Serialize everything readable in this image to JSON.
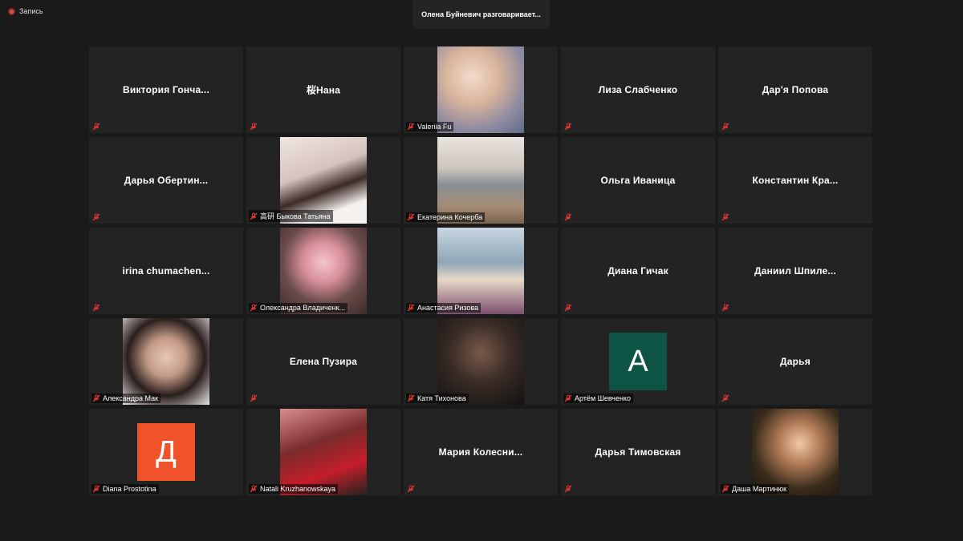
{
  "recording": {
    "label": "Запись"
  },
  "active_speaker": "Олена Буйневич разговаривает...",
  "tiles": [
    {
      "kind": "name",
      "name": "Виктория  Гонча...",
      "label": ""
    },
    {
      "kind": "name",
      "name": "桜Нана",
      "label": ""
    },
    {
      "kind": "video",
      "label": "Valeriia Fu",
      "scene": "sky"
    },
    {
      "kind": "name",
      "name": "Лиза Слабченко",
      "label": ""
    },
    {
      "kind": "name",
      "name": "Дар'я Попова",
      "label": ""
    },
    {
      "kind": "name",
      "name": "Дарья  Обертин...",
      "label": ""
    },
    {
      "kind": "video",
      "label": "高研 Быкова Татьяна",
      "scene": "room1"
    },
    {
      "kind": "video",
      "label": "Екатерина Кочерба",
      "scene": "beach1"
    },
    {
      "kind": "name",
      "name": "Ольга Иваница",
      "label": ""
    },
    {
      "kind": "name",
      "name": "Константин  Кра...",
      "label": ""
    },
    {
      "kind": "name",
      "name": "irina  chumachen...",
      "label": ""
    },
    {
      "kind": "video",
      "label": "Олександра Владиченк...",
      "scene": "pink"
    },
    {
      "kind": "video",
      "label": "Анастасия Ризова",
      "scene": "beach2"
    },
    {
      "kind": "name",
      "name": "Диана Гичак",
      "label": ""
    },
    {
      "kind": "name",
      "name": "Даниил  Шпиле...",
      "label": ""
    },
    {
      "kind": "video",
      "label": "Александра Мак",
      "scene": "woman1"
    },
    {
      "kind": "name",
      "name": "Елена Пузира",
      "label": ""
    },
    {
      "kind": "video",
      "label": "Катя Тихонова",
      "scene": "dark"
    },
    {
      "kind": "avatar",
      "letter": "A",
      "label": "Артём Шевченко",
      "color": "#0e5445"
    },
    {
      "kind": "name",
      "name": "Дарья",
      "label": ""
    },
    {
      "kind": "avatar",
      "letter": "Д",
      "label": "Diana Prostotina",
      "color": "#f0522a"
    },
    {
      "kind": "video",
      "label": "Natali Kruzhanowskaya",
      "scene": "red"
    },
    {
      "kind": "name",
      "name": "Мария  Колесни...",
      "label": ""
    },
    {
      "kind": "name",
      "name": "Дарья Тимовская",
      "label": ""
    },
    {
      "kind": "video",
      "label": "Даша Мартинюк",
      "scene": "night"
    }
  ],
  "colors": {
    "background": "#1a1a1a",
    "tile": "#232323",
    "muted_mic": "#e03535"
  },
  "icons": {
    "muted": "mic-muted-icon",
    "record": "record-dot-icon"
  }
}
